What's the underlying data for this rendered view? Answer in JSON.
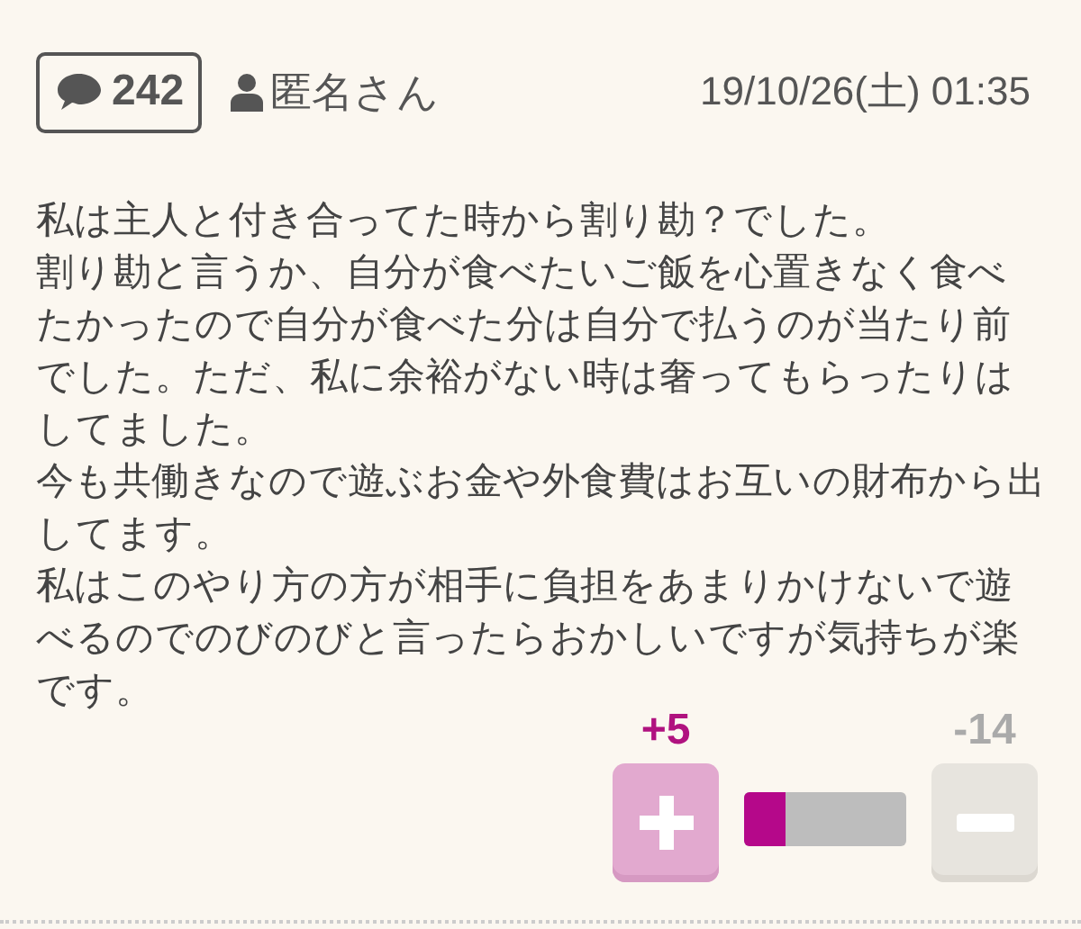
{
  "comment_count": "242",
  "author": "匿名さん",
  "date": "19/10/26(土) 01:35",
  "body": [
    "私は主人と付き合ってた時から割り勘？でした。",
    "割り勘と言うか、自分が食べたいご飯を心置きなく食べたかったので自分が食べた分は自分で払うのが当たり前でした。ただ、私に余裕がない時は奢ってもらったりはしてました。",
    "今も共働きなので遊ぶお金や外食費はお互いの財布から出してます。",
    "私はこのやり方の方が相手に負担をあまりかけないで遊べるのでのびのびと言ったらおかしいですが気持ちが楽です。"
  ],
  "votes": {
    "plus": "+5",
    "minus": "-14",
    "level": 0.26
  }
}
